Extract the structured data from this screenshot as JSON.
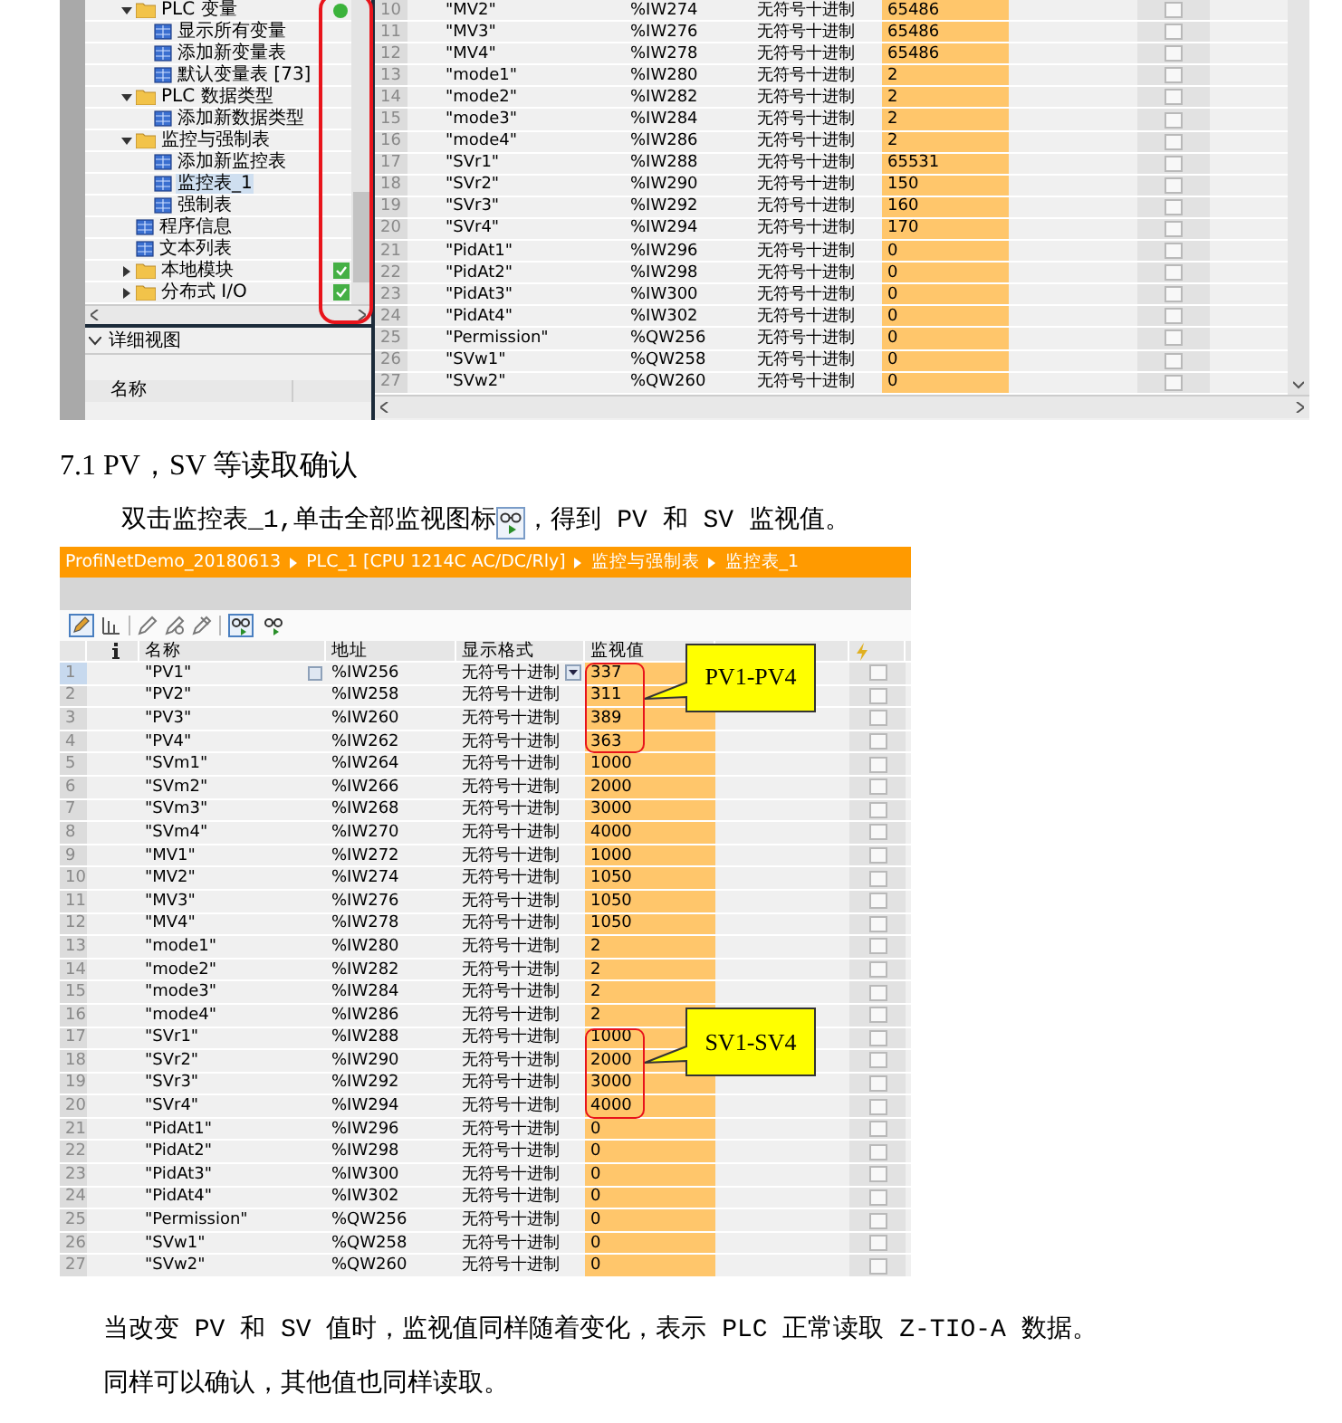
{
  "top_screenshot": {
    "tree": [
      {
        "label": "PLC 变量",
        "expanded": true,
        "selected": false,
        "status": {
          "kind": "dot"
        },
        "children": [
          {
            "label": "显示所有变量",
            "selected": false
          },
          {
            "label": "添加新变量表",
            "selected": false
          },
          {
            "label": "默认变量表 [73]",
            "selected": false
          }
        ]
      },
      {
        "label": "PLC 数据类型",
        "expanded": true,
        "selected": false,
        "children": [
          {
            "label": "添加新数据类型",
            "selected": false
          }
        ]
      },
      {
        "label": "监控与强制表",
        "expanded": true,
        "selected": false,
        "children": [
          {
            "label": "添加新监控表",
            "selected": false
          },
          {
            "label": "监控表_1",
            "selected": true
          },
          {
            "label": "强制表",
            "selected": false
          }
        ]
      },
      {
        "label": "程序信息",
        "selected": false
      },
      {
        "label": "文本列表",
        "selected": false
      },
      {
        "label": "本地模块",
        "expanded": false,
        "selected": false,
        "status": {
          "kind": "check"
        }
      },
      {
        "label": "分布式 I/O",
        "expanded": false,
        "selected": false,
        "status": {
          "kind": "check"
        }
      }
    ],
    "detail_view": {
      "title": "详细视图",
      "columns": [
        "名称"
      ]
    },
    "table": {
      "rows": [
        {
          "n": "10",
          "name": "\"MV2\"",
          "address": "%IW274",
          "format": "无符号十进制",
          "value": "65486",
          "checked": false
        },
        {
          "n": "11",
          "name": "\"MV3\"",
          "address": "%IW276",
          "format": "无符号十进制",
          "value": "65486",
          "checked": false
        },
        {
          "n": "12",
          "name": "\"MV4\"",
          "address": "%IW278",
          "format": "无符号十进制",
          "value": "65486",
          "checked": false
        },
        {
          "n": "13",
          "name": "\"mode1\"",
          "address": "%IW280",
          "format": "无符号十进制",
          "value": "2",
          "checked": false
        },
        {
          "n": "14",
          "name": "\"mode2\"",
          "address": "%IW282",
          "format": "无符号十进制",
          "value": "2",
          "checked": false
        },
        {
          "n": "15",
          "name": "\"mode3\"",
          "address": "%IW284",
          "format": "无符号十进制",
          "value": "2",
          "checked": false
        },
        {
          "n": "16",
          "name": "\"mode4\"",
          "address": "%IW286",
          "format": "无符号十进制",
          "value": "2",
          "checked": false
        },
        {
          "n": "17",
          "name": "\"SVr1\"",
          "address": "%IW288",
          "format": "无符号十进制",
          "value": "65531",
          "checked": false
        },
        {
          "n": "18",
          "name": "\"SVr2\"",
          "address": "%IW290",
          "format": "无符号十进制",
          "value": "150",
          "checked": false
        },
        {
          "n": "19",
          "name": "\"SVr3\"",
          "address": "%IW292",
          "format": "无符号十进制",
          "value": "160",
          "checked": false
        },
        {
          "n": "20",
          "name": "\"SVr4\"",
          "address": "%IW294",
          "format": "无符号十进制",
          "value": "170",
          "checked": false
        },
        {
          "n": "21",
          "name": "\"PidAt1\"",
          "address": "%IW296",
          "format": "无符号十进制",
          "value": "0",
          "checked": false
        },
        {
          "n": "22",
          "name": "\"PidAt2\"",
          "address": "%IW298",
          "format": "无符号十进制",
          "value": "0",
          "checked": false
        },
        {
          "n": "23",
          "name": "\"PidAt3\"",
          "address": "%IW300",
          "format": "无符号十进制",
          "value": "0",
          "checked": false
        },
        {
          "n": "24",
          "name": "\"PidAt4\"",
          "address": "%IW302",
          "format": "无符号十进制",
          "value": "0",
          "checked": false
        },
        {
          "n": "25",
          "name": "\"Permission\"",
          "address": "%QW256",
          "format": "无符号十进制",
          "value": "0",
          "checked": false
        },
        {
          "n": "26",
          "name": "\"SVw1\"",
          "address": "%QW258",
          "format": "无符号十进制",
          "value": "0",
          "checked": false
        },
        {
          "n": "27",
          "name": "\"SVw2\"",
          "address": "%QW260",
          "format": "无符号十进制",
          "value": "0",
          "checked": false
        }
      ]
    }
  },
  "heading": "7.1 PV，SV 等读取确认",
  "instruction": {
    "before": "双击监控表_1,单击全部监视图标",
    "after": "，得到 PV 和 SV 监视值。"
  },
  "watch_table": {
    "breadcrumb": [
      "ProfiNetDemo_20180613",
      "PLC_1 [CPU 1214C AC/DC/Rly]",
      "监控与强制表",
      "监控表_1"
    ],
    "columns": [
      "名称",
      "地址",
      "显示格式",
      "监视值"
    ],
    "rows": [
      {
        "n": "1",
        "name": "\"PV1\"",
        "address": "%IW256",
        "format": "无符号十进制",
        "value": "337",
        "checked": false,
        "selected": true,
        "marked": true
      },
      {
        "n": "2",
        "name": "\"PV2\"",
        "address": "%IW258",
        "format": "无符号十进制",
        "value": "311",
        "checked": false,
        "selected": false,
        "marked": true,
        "callout": "PV1-PV4"
      },
      {
        "n": "3",
        "name": "\"PV3\"",
        "address": "%IW260",
        "format": "无符号十进制",
        "value": "389",
        "checked": false,
        "selected": false,
        "marked": true
      },
      {
        "n": "4",
        "name": "\"PV4\"",
        "address": "%IW262",
        "format": "无符号十进制",
        "value": "363",
        "checked": false,
        "selected": false,
        "marked": true
      },
      {
        "n": "5",
        "name": "\"SVm1\"",
        "address": "%IW264",
        "format": "无符号十进制",
        "value": "1000",
        "checked": false,
        "selected": false,
        "marked": false
      },
      {
        "n": "6",
        "name": "\"SVm2\"",
        "address": "%IW266",
        "format": "无符号十进制",
        "value": "2000",
        "checked": false,
        "selected": false,
        "marked": false
      },
      {
        "n": "7",
        "name": "\"SVm3\"",
        "address": "%IW268",
        "format": "无符号十进制",
        "value": "3000",
        "checked": false,
        "selected": false,
        "marked": false
      },
      {
        "n": "8",
        "name": "\"SVm4\"",
        "address": "%IW270",
        "format": "无符号十进制",
        "value": "4000",
        "checked": false,
        "selected": false,
        "marked": false
      },
      {
        "n": "9",
        "name": "\"MV1\"",
        "address": "%IW272",
        "format": "无符号十进制",
        "value": "1000",
        "checked": false,
        "selected": false,
        "marked": false
      },
      {
        "n": "10",
        "name": "\"MV2\"",
        "address": "%IW274",
        "format": "无符号十进制",
        "value": "1050",
        "checked": false,
        "selected": false,
        "marked": false
      },
      {
        "n": "11",
        "name": "\"MV3\"",
        "address": "%IW276",
        "format": "无符号十进制",
        "value": "1050",
        "checked": false,
        "selected": false,
        "marked": false
      },
      {
        "n": "12",
        "name": "\"MV4\"",
        "address": "%IW278",
        "format": "无符号十进制",
        "value": "1050",
        "checked": false,
        "selected": false,
        "marked": false
      },
      {
        "n": "13",
        "name": "\"mode1\"",
        "address": "%IW280",
        "format": "无符号十进制",
        "value": "2",
        "checked": false,
        "selected": false,
        "marked": false
      },
      {
        "n": "14",
        "name": "\"mode2\"",
        "address": "%IW282",
        "format": "无符号十进制",
        "value": "2",
        "checked": false,
        "selected": false,
        "marked": false
      },
      {
        "n": "15",
        "name": "\"mode3\"",
        "address": "%IW284",
        "format": "无符号十进制",
        "value": "2",
        "checked": false,
        "selected": false,
        "marked": false
      },
      {
        "n": "16",
        "name": "\"mode4\"",
        "address": "%IW286",
        "format": "无符号十进制",
        "value": "2",
        "checked": false,
        "selected": false,
        "marked": false
      },
      {
        "n": "17",
        "name": "\"SVr1\"",
        "address": "%IW288",
        "format": "无符号十进制",
        "value": "1000",
        "checked": false,
        "selected": false,
        "marked": true
      },
      {
        "n": "18",
        "name": "\"SVr2\"",
        "address": "%IW290",
        "format": "无符号十进制",
        "value": "2000",
        "checked": false,
        "selected": false,
        "marked": true,
        "callout": "SV1-SV4"
      },
      {
        "n": "19",
        "name": "\"SVr3\"",
        "address": "%IW292",
        "format": "无符号十进制",
        "value": "3000",
        "checked": false,
        "selected": false,
        "marked": true
      },
      {
        "n": "20",
        "name": "\"SVr4\"",
        "address": "%IW294",
        "format": "无符号十进制",
        "value": "4000",
        "checked": false,
        "selected": false,
        "marked": true
      },
      {
        "n": "21",
        "name": "\"PidAt1\"",
        "address": "%IW296",
        "format": "无符号十进制",
        "value": "0",
        "checked": false,
        "selected": false,
        "marked": false
      },
      {
        "n": "22",
        "name": "\"PidAt2\"",
        "address": "%IW298",
        "format": "无符号十进制",
        "value": "0",
        "checked": false,
        "selected": false,
        "marked": false
      },
      {
        "n": "23",
        "name": "\"PidAt3\"",
        "address": "%IW300",
        "format": "无符号十进制",
        "value": "0",
        "checked": false,
        "selected": false,
        "marked": false
      },
      {
        "n": "24",
        "name": "\"PidAt4\"",
        "address": "%IW302",
        "format": "无符号十进制",
        "value": "0",
        "checked": false,
        "selected": false,
        "marked": false
      },
      {
        "n": "25",
        "name": "\"Permission\"",
        "address": "%QW256",
        "format": "无符号十进制",
        "value": "0",
        "checked": false,
        "selected": false,
        "marked": false
      },
      {
        "n": "26",
        "name": "\"SVw1\"",
        "address": "%QW258",
        "format": "无符号十进制",
        "value": "0",
        "checked": false,
        "selected": false,
        "marked": false
      },
      {
        "n": "27",
        "name": "\"SVw2\"",
        "address": "%QW260",
        "format": "无符号十进制",
        "value": "0",
        "checked": false,
        "selected": false,
        "marked": false
      }
    ]
  },
  "notes": [
    "当改变 PV 和 SV 值时，监视值同样随着变化，表示 PLC 正常读取 Z-TIO-A 数据。",
    "同样可以确认，其他值也同样读取。"
  ]
}
